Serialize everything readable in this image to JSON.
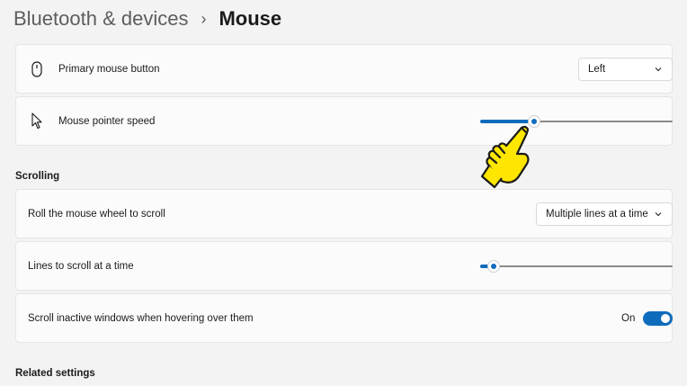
{
  "breadcrumb": {
    "parent": "Bluetooth & devices",
    "separator": "›",
    "current": "Mouse"
  },
  "primary_button": {
    "label": "Primary mouse button",
    "icon": "mouse-icon",
    "value": "Left"
  },
  "pointer_speed": {
    "label": "Mouse pointer speed",
    "icon": "pointer-arrow-icon",
    "level_fraction": 0.28
  },
  "scrolling": {
    "heading": "Scrolling",
    "wheel": {
      "label": "Roll the mouse wheel to scroll",
      "value": "Multiple lines at a time"
    },
    "lines": {
      "label": "Lines to scroll at a time",
      "level_fraction": 0.07
    },
    "inactive": {
      "label": "Scroll inactive windows when hovering over them",
      "state_text": "On",
      "on": true
    }
  },
  "related": {
    "heading": "Related settings"
  },
  "cursor_overlay": {
    "icon": "hand-pointer-icon"
  },
  "colors": {
    "accent": "#0f6cbd",
    "hand_fill": "#ffe600"
  }
}
